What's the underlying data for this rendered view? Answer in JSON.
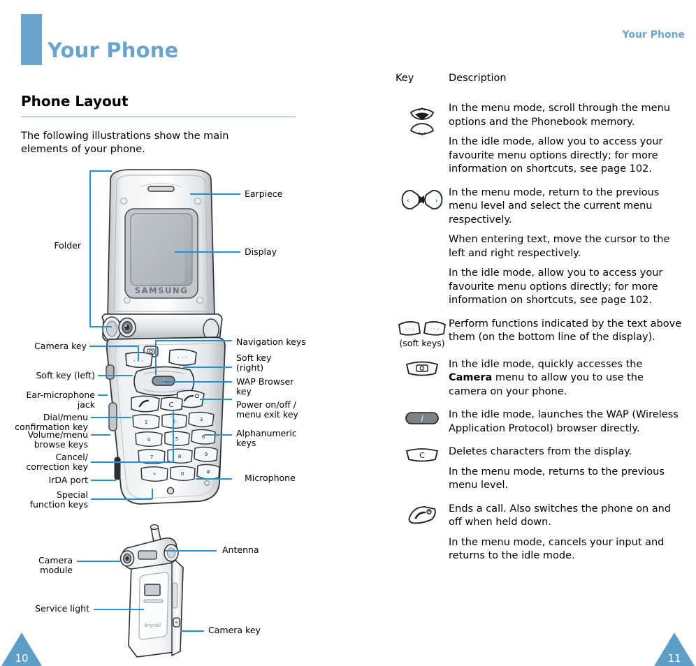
{
  "header": {
    "chapter_title": "Your Phone",
    "running_head": "Your Phone",
    "accent_color": "#6aa4cc"
  },
  "left_column": {
    "section_title": "Phone Layout",
    "intro": "The following illustrations show the main elements of your phone.",
    "figure_top_labels": [
      {
        "name": "earpiece",
        "text": "Earpiece"
      },
      {
        "name": "display",
        "text": "Display"
      },
      {
        "name": "folder",
        "text": "Folder"
      },
      {
        "name": "camera-key",
        "text": "Camera key"
      },
      {
        "name": "soft-key-left",
        "text": "Soft key (left)"
      },
      {
        "name": "ear-microphone-jack",
        "text": "Ear-microphone\njack"
      },
      {
        "name": "dial-menu-confirmation-key",
        "text": "Dial/menu\nconfirmation key"
      },
      {
        "name": "volume-menu-browse-keys",
        "text": "Volume/menu\nbrowse keys"
      },
      {
        "name": "cancel-correction-key",
        "text": "Cancel/\ncorrection key"
      },
      {
        "name": "irda-port",
        "text": "IrDA port"
      },
      {
        "name": "special-function-keys",
        "text": "Special\nfunction keys"
      },
      {
        "name": "navigation-keys",
        "text": "Navigation keys"
      },
      {
        "name": "soft-key-right",
        "text": "Soft key\n(right)"
      },
      {
        "name": "wap-browser-key",
        "text": "WAP Browser\nkey"
      },
      {
        "name": "power-menu-exit-key",
        "text": "Power on/off /\nmenu exit key"
      },
      {
        "name": "alphanumeric-keys",
        "text": "Alphanumeric\nkeys"
      },
      {
        "name": "microphone",
        "text": "Microphone"
      }
    ],
    "figure_bottom_labels": [
      {
        "name": "antenna",
        "text": "Antenna"
      },
      {
        "name": "camera-module",
        "text": "Camera\nmodule"
      },
      {
        "name": "service-light",
        "text": "Service light"
      },
      {
        "name": "camera-key-side",
        "text": "Camera key"
      }
    ],
    "brand_on_phone": "SAMSUNG",
    "brand_on_back": "Anycall",
    "page_number": "10"
  },
  "right_column": {
    "table_headers": {
      "key": "Key",
      "description": "Description"
    },
    "rows": [
      {
        "key_icon": "up-down-navigation-key-icon",
        "key_caption": "",
        "paragraphs": [
          "In the menu mode, scroll through the menu options and the Phonebook memory.",
          "In the idle mode, allow you to access your favourite menu options directly; for more information on shortcuts, see page 102."
        ]
      },
      {
        "key_icon": "left-right-navigation-key-icon",
        "key_caption": "",
        "paragraphs": [
          "In the menu mode, return to the previous menu level and select the current menu respectively.",
          "When entering text, move the cursor to the left and right respectively.",
          "In the idle mode, allow you to access your favourite menu options directly; for more information on shortcuts, see page 102."
        ]
      },
      {
        "key_icon": "soft-keys-icon",
        "key_caption": "(soft keys)",
        "paragraphs": [
          "Perform functions indicated by the text above them (on the bottom line of the display)."
        ]
      },
      {
        "key_icon": "camera-key-icon",
        "key_caption": "",
        "paragraphs_rich": [
          {
            "pre": "In the idle mode, quickly accesses the ",
            "bold": "Camera",
            "post": " menu to allow you to use the camera on your phone."
          }
        ]
      },
      {
        "key_icon": "wap-browser-key-icon",
        "key_caption": "",
        "paragraphs": [
          "In the idle mode, launches the WAP (Wireless Application Protocol) browser directly."
        ]
      },
      {
        "key_icon": "clear-key-icon",
        "key_caption": "",
        "paragraphs": [
          "Deletes characters from the display.",
          "In the menu mode, returns to the previous menu level."
        ]
      },
      {
        "key_icon": "end-call-power-key-icon",
        "key_caption": "",
        "paragraphs": [
          "Ends a call. Also switches the phone on and off when held down.",
          "In the menu mode, cancels your input and returns to the idle mode."
        ]
      }
    ],
    "page_number": "11"
  }
}
